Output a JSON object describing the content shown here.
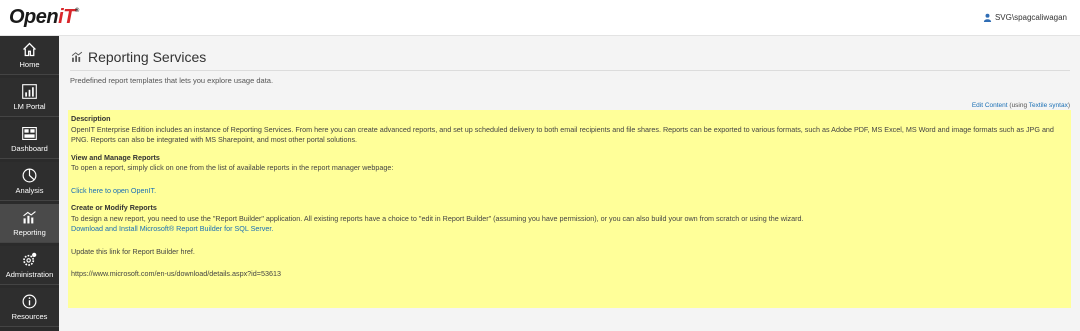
{
  "header": {
    "logo_main": "Open",
    "logo_accent": "iT",
    "logo_mark": "®",
    "username": "SVG\\spagcaliwagan"
  },
  "sidebar": {
    "items": [
      {
        "label": "Home",
        "icon": "home-icon"
      },
      {
        "label": "LM Portal",
        "icon": "bar-chart-icon"
      },
      {
        "label": "Dashboard",
        "icon": "dashboard-icon"
      },
      {
        "label": "Analysis",
        "icon": "analysis-icon"
      },
      {
        "label": "Reporting",
        "icon": "reporting-icon",
        "active": true
      },
      {
        "label": "Administration",
        "icon": "gear-icon"
      },
      {
        "label": "Resources",
        "icon": "info-icon"
      }
    ]
  },
  "main": {
    "title": "Reporting Services",
    "subtitle": "Predefined report templates that lets you explore usage data.",
    "edit_link": "Edit Content",
    "edit_suffix_open": " (using ",
    "edit_syntax_link": "Textile syntax",
    "edit_suffix_close": ")",
    "sections": {
      "description_heading": "Description",
      "description_text": "OpenIT Enterprise Edition includes an instance of Reporting Services. From here you can create advanced reports, and set up scheduled delivery to both email recipients and file shares. Reports can be exported to various formats, such as Adobe PDF, MS Excel, MS Word and image formats such as JPG and PNG. Reports can also be integrated with MS Sharepoint, and most other portal solutions.",
      "view_heading": "View and Manage Reports",
      "view_text": "To open a report, simply click on one from the list of available reports in the report manager webpage:",
      "view_link": "Click here to open OpenIT.",
      "create_heading": "Create or Modify Reports",
      "create_text": "To design a new report, you need to use the \"Report Builder\" application. All existing reports have a choice to \"edit in Report Builder\" (assuming you have permission), or you can also build your own from scratch or using the wizard.",
      "create_link": "Download and Install Microsoft® Report Builder for SQL Server.",
      "update_note": "Update this link for Report Builder href.",
      "url_text": "https://www.microsoft.com/en-us/download/details.aspx?id=53613"
    }
  },
  "colors": {
    "sidebar_bg": "#2b2b2b",
    "sidebar_active": "#4a4a4a",
    "panel_bg": "#ffff99",
    "link": "#1a6fb5",
    "brand_red": "#d9262b"
  }
}
